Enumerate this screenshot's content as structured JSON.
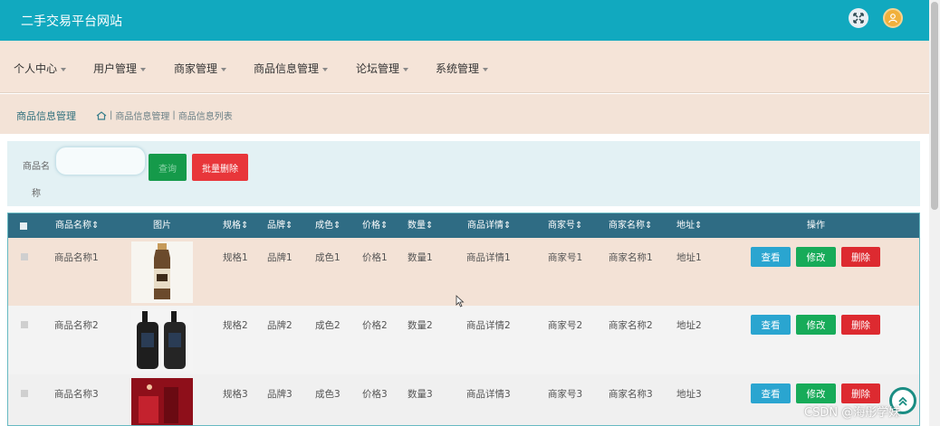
{
  "header": {
    "title": "二手交易平台网站"
  },
  "nav": [
    {
      "label": "个人中心"
    },
    {
      "label": "用户管理"
    },
    {
      "label": "商家管理"
    },
    {
      "label": "商品信息管理"
    },
    {
      "label": "论坛管理"
    },
    {
      "label": "系统管理"
    }
  ],
  "breadcrumb": {
    "title": "商品信息管理",
    "path": [
      "商品信息管理",
      "商品信息列表"
    ],
    "separator": "|"
  },
  "search": {
    "label": "商品名称",
    "value": "",
    "placeholder": "",
    "search_button": "查询",
    "batch_delete_button": "批量删除"
  },
  "table": {
    "headers": [
      "商品名称",
      "图片",
      "规格",
      "品牌",
      "成色",
      "价格",
      "数量",
      "商品详情",
      "商家号",
      "商家名称",
      "地址",
      "操作"
    ],
    "sortable_mark": "⇕",
    "rows": [
      {
        "name": "商品名称1",
        "spec": "规格1",
        "brand": "品牌1",
        "condition": "成色1",
        "price": "价格1",
        "qty": "数量1",
        "detail": "商品详情1",
        "merchant_no": "商家号1",
        "merchant_name": "商家名称1",
        "address": "地址1"
      },
      {
        "name": "商品名称2",
        "spec": "规格2",
        "brand": "品牌2",
        "condition": "成色2",
        "price": "价格2",
        "qty": "数量2",
        "detail": "商品详情2",
        "merchant_no": "商家号2",
        "merchant_name": "商家名称2",
        "address": "地址2"
      },
      {
        "name": "商品名称3",
        "spec": "规格3",
        "brand": "品牌3",
        "condition": "成色3",
        "price": "价格3",
        "qty": "数量3",
        "detail": "商品详情3",
        "merchant_no": "商家号3",
        "merchant_name": "商家名称3",
        "address": "地址3"
      }
    ],
    "actions": {
      "view": "查看",
      "edit": "修改",
      "delete": "删除"
    }
  },
  "watermark": "CSDN @海彤学妹",
  "colors": {
    "header": "#11a9bf",
    "nav": "#f5e4d8",
    "table_head": "#2f6c84",
    "view": "#2aa5d0",
    "edit": "#17ab59",
    "delete": "#dd2a30"
  },
  "icons": [
    "expand-icon",
    "user-avatar-icon",
    "home-icon",
    "back-to-top-icon"
  ]
}
